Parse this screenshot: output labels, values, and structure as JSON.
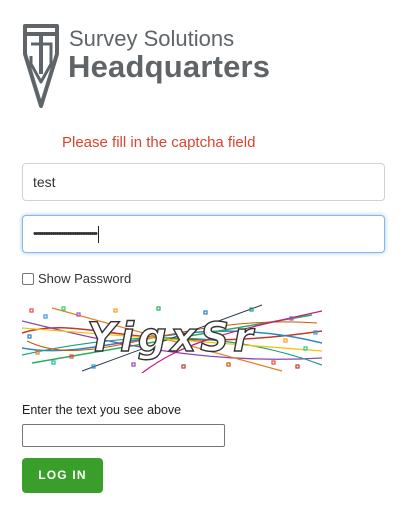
{
  "header": {
    "brand_line1": "Survey Solutions",
    "brand_line2": "Headquarters"
  },
  "error_message": "Please fill in the captcha field",
  "login_form": {
    "username_value": "test",
    "password_masked": "••••••••••••••••••••••••••••••••••",
    "show_password_label": "Show Password",
    "show_password_checked": false,
    "captcha_text": "YigxSr",
    "captcha_prompt": "Enter the text you see above",
    "captcha_value": "",
    "login_label": "LOG IN"
  },
  "colors": {
    "logo_gray": "#5f6468",
    "error_red": "#d9442f",
    "login_green": "#3a9f2a",
    "focus_blue": "#86b7e6"
  }
}
